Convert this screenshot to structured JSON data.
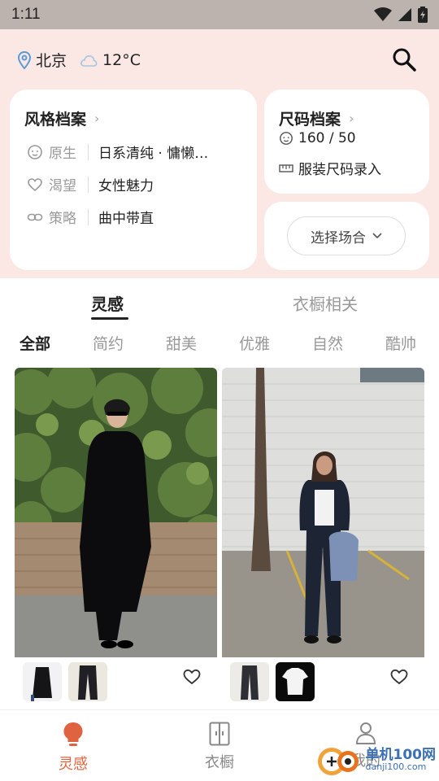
{
  "status_bar": {
    "time": "1:11"
  },
  "header": {
    "city": "北京",
    "temperature": "12°C"
  },
  "style_profile": {
    "title": "风格档案",
    "rows": [
      {
        "label": "原生",
        "value": "日系清纯 · 慵懒…"
      },
      {
        "label": "渴望",
        "value": "女性魅力"
      },
      {
        "label": "策略",
        "value": "曲中带直"
      }
    ]
  },
  "size_profile": {
    "title": "尺码档案",
    "measurement": "160 / 50",
    "entry_label": "服装尺码录入"
  },
  "occasion": {
    "button_label": "选择场合"
  },
  "tabs": [
    {
      "label": "灵感",
      "active": true
    },
    {
      "label": "衣橱相关",
      "active": false
    }
  ],
  "filters": [
    {
      "label": "全部",
      "active": true
    },
    {
      "label": "简约",
      "active": false
    },
    {
      "label": "甜美",
      "active": false
    },
    {
      "label": "优雅",
      "active": false
    },
    {
      "label": "自然",
      "active": false
    },
    {
      "label": "酷帅",
      "active": false
    }
  ],
  "feed": [
    {
      "thumbs": [
        "black-coat",
        "dark-trousers"
      ],
      "favorited": false
    },
    {
      "thumbs": [
        "grey-trousers",
        "white-tee"
      ],
      "favorited": false
    }
  ],
  "bottom_nav": [
    {
      "label": "灵感",
      "icon": "lightbulb-icon",
      "active": true
    },
    {
      "label": "衣橱",
      "icon": "wardrobe-icon",
      "active": false
    },
    {
      "label": "我的",
      "icon": "person-icon",
      "active": false
    }
  ],
  "watermark": {
    "name": "单机100网",
    "url": "danji100.com"
  },
  "colors": {
    "accent": "#e0633f",
    "header_bg": "#fbe8e5",
    "status_bar": "#bdb3ae"
  }
}
